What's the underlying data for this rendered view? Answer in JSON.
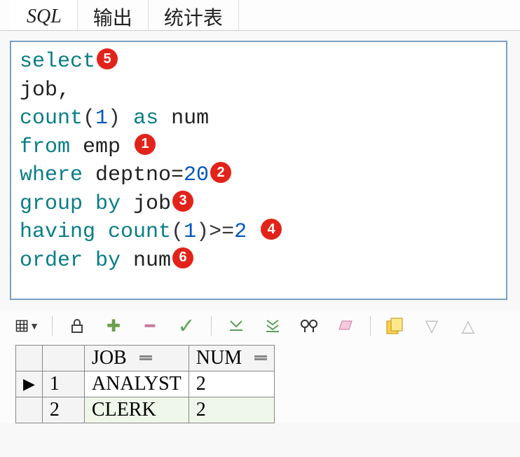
{
  "tabs": {
    "sql": "SQL",
    "output": "输出",
    "stats": "统计表"
  },
  "sql": {
    "select": "select",
    "job": "job,",
    "count_as": "count",
    "lparen1": "(",
    "one1": "1",
    "rparen_as": ") ",
    "as": "as",
    "numlbl": " num",
    "from": "from",
    "emp": " emp ",
    "where": "where",
    "deptno": " deptno=",
    "twenty": "20",
    "groupby": "group by",
    "jobid": " job",
    "having": "having",
    "count2": " count",
    "lparen2": "(",
    "one2": "1",
    "rparen2": ")",
    "gte": ">=",
    "two": "2",
    "orderby": "order by",
    "numid": " num"
  },
  "badges": {
    "b1": "1",
    "b2": "2",
    "b3": "3",
    "b4": "4",
    "b5": "5",
    "b6": "6"
  },
  "columns": {
    "job": "JOB",
    "num": "NUM"
  },
  "rows": [
    {
      "ptr": "▶",
      "n": "1",
      "job": "ANALYST",
      "num": "2"
    },
    {
      "ptr": "",
      "n": "2",
      "job": "CLERK",
      "num": "2"
    }
  ]
}
